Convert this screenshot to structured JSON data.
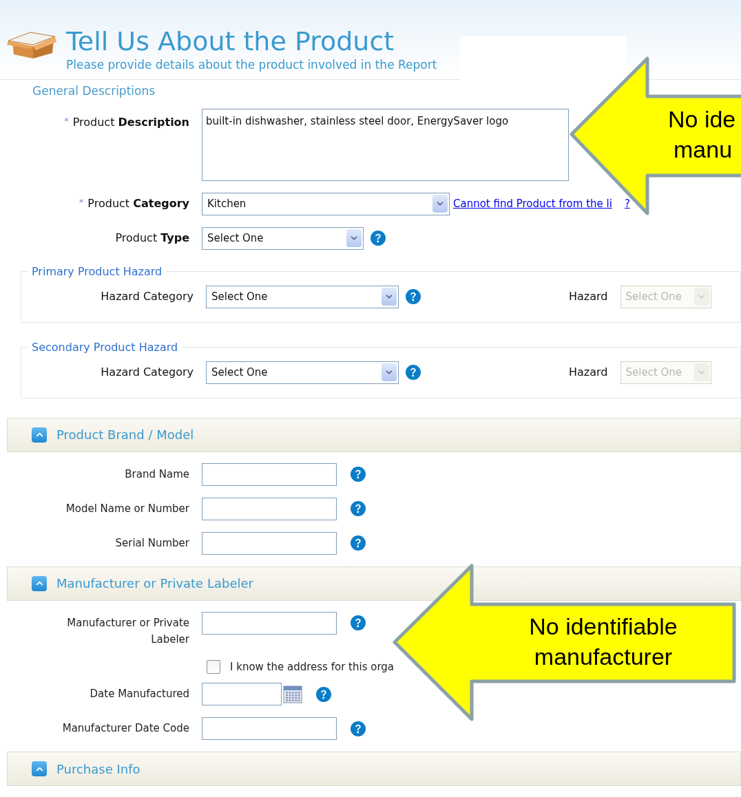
{
  "header": {
    "title": "Tell Us About the Product",
    "subtitle": "Please provide details about the product involved in the Report"
  },
  "general": {
    "legend": "General Descriptions",
    "description": {
      "label": "Product **Description**",
      "marker": "*",
      "value": "built-in dishwasher, stainless steel door, EnergySaver logo"
    },
    "category": {
      "label": "Product **Category**",
      "marker": "*",
      "value": "Kitchen",
      "link": "Cannot find Product from the li",
      "link_tail": "?"
    },
    "type": {
      "label": "Product **Type**",
      "value": "Select One"
    }
  },
  "hazard_groups": [
    {
      "legend": "Primary Product Hazard",
      "category_label": "Hazard Category",
      "category_value": "Select One",
      "hazard_label": "Hazard",
      "hazard_value": "Select One",
      "hazard_disabled": true
    },
    {
      "legend": "Secondary Product Hazard",
      "category_label": "Hazard Category",
      "category_value": "Select One",
      "hazard_label": "Hazard",
      "hazard_value": "Select One",
      "hazard_disabled": true
    }
  ],
  "sections": [
    {
      "title": "Product Brand / Model",
      "expanded": true,
      "fields": [
        {
          "kind": "text",
          "label": "Brand Name"
        },
        {
          "kind": "text",
          "label": "Model Name or Number"
        },
        {
          "kind": "text",
          "label": "Serial Number"
        }
      ]
    },
    {
      "title": "Manufacturer or Private Labeler",
      "expanded": true,
      "fields": [
        {
          "kind": "text",
          "label": "Manufacturer or Private Labeler"
        },
        {
          "kind": "checkbox",
          "label": "I know the address for this orga",
          "checked": false
        },
        {
          "kind": "date",
          "label": "Date Manufactured"
        },
        {
          "kind": "text",
          "label": "Manufacturer Date Code"
        }
      ]
    },
    {
      "title": "Purchase Info",
      "expanded": true
    }
  ],
  "callouts": [
    {
      "lines": [
        "No ide",
        "manu"
      ]
    },
    {
      "lines": [
        "No identifiable",
        "manufacturer"
      ]
    }
  ]
}
